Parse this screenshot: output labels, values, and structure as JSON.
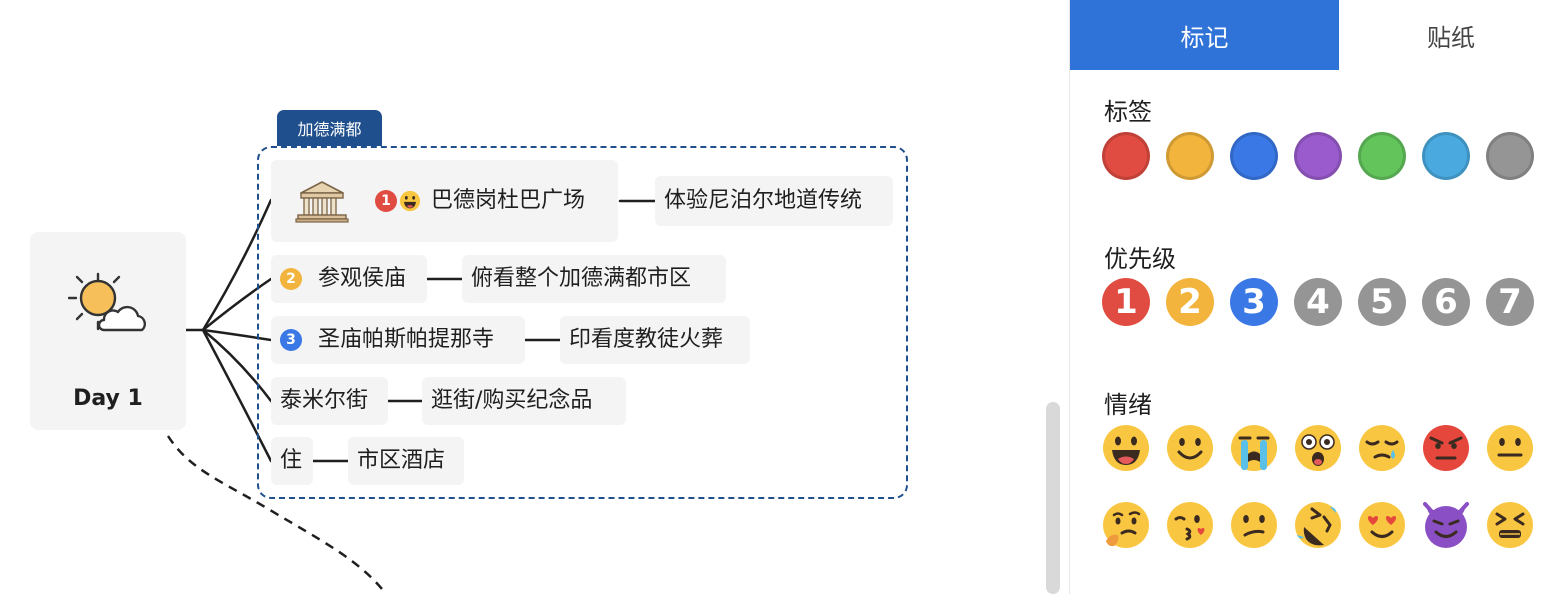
{
  "mindmap": {
    "root": {
      "label": "Day 1"
    },
    "boundary": {
      "title": "加德满都"
    },
    "topics": [
      {
        "label": "巴德岗杜巴广场",
        "priority": "1",
        "child": "体验尼泊尔地道传统"
      },
      {
        "label": "参观侯庙",
        "priority": "2",
        "child": "俯看整个加德满都市区"
      },
      {
        "label": "圣庙帕斯帕提那寺",
        "priority": "3",
        "child": "印看度教徒火葬"
      },
      {
        "label": "泰米尔街",
        "child": "逛街/购买纪念品"
      },
      {
        "label": "住",
        "child": "市区酒店"
      }
    ],
    "icons": {
      "root": "sun-cloud-icon",
      "topic1": "temple-icon"
    }
  },
  "panel": {
    "tabs": [
      {
        "label": "标记",
        "active": true
      },
      {
        "label": "贴纸",
        "active": false
      }
    ],
    "sections": {
      "tags": {
        "title": "标签",
        "colors": [
          "#e04c41",
          "#f2b43c",
          "#3a78e6",
          "#9a5ccc",
          "#63c45c",
          "#4aaae0",
          "#959595"
        ]
      },
      "priority": {
        "title": "优先级",
        "items": [
          {
            "label": "1",
            "color": "#e04c41"
          },
          {
            "label": "2",
            "color": "#f2b43c"
          },
          {
            "label": "3",
            "color": "#3a78e6"
          },
          {
            "label": "4",
            "color": "#959595"
          },
          {
            "label": "5",
            "color": "#959595"
          },
          {
            "label": "6",
            "color": "#959595"
          },
          {
            "label": "7",
            "color": "#959595"
          }
        ]
      },
      "mood": {
        "title": "情绪",
        "row1": [
          "grinning-face-icon",
          "smiling-face-icon",
          "crying-face-icon",
          "astonished-face-icon",
          "sleepy-face-icon",
          "angry-face-icon",
          "neutral-face-icon"
        ],
        "row2": [
          "thinking-face-icon",
          "kissing-face-icon",
          "confused-face-icon",
          "rolling-laughing-face-icon",
          "heart-eyes-face-icon",
          "smiling-devil-icon",
          "squinting-face-icon"
        ]
      }
    }
  },
  "colors": {
    "accent": "#2f73d9",
    "boundary": "#1f4f8c",
    "node_bg": "#f4f4f4"
  }
}
